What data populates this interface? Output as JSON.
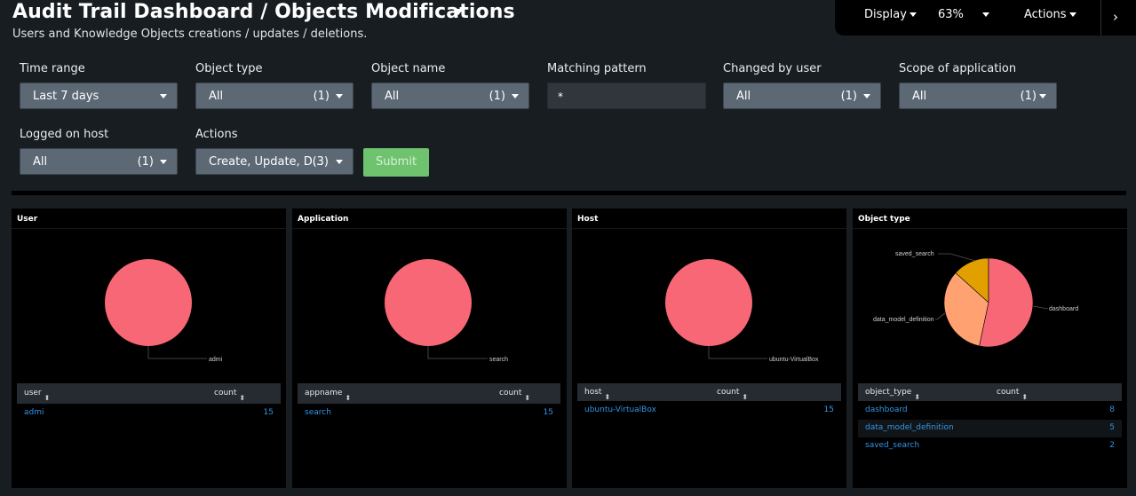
{
  "header": {
    "title": "Audit Trail Dashboard / Objects Modifications",
    "subtitle": "Users and Knowledge Objects creations / updates / deletions."
  },
  "toolbar": {
    "display": "Display",
    "zoom": "63%",
    "actions": "Actions"
  },
  "filters": {
    "time_range": {
      "label": "Time range",
      "value": "Last 7 days"
    },
    "object_type": {
      "label": "Object type",
      "value": "All",
      "count": "(1)"
    },
    "object_name": {
      "label": "Object name",
      "value": "All",
      "count": "(1)"
    },
    "matching_pattern": {
      "label": "Matching pattern",
      "value": "*"
    },
    "changed_by_user": {
      "label": "Changed by user",
      "value": "All",
      "count": "(1)"
    },
    "scope": {
      "label": "Scope of application",
      "value": "All",
      "count": "(1)"
    },
    "host": {
      "label": "Logged on host",
      "value": "All",
      "count": "(1)"
    },
    "actions": {
      "label": "Actions",
      "value": "Create, Update, D...",
      "count": "(3)"
    },
    "submit_label": "Submit"
  },
  "panels": {
    "user": {
      "title": "User",
      "columns": [
        "user",
        "count"
      ],
      "rows": [
        [
          "admi",
          "15"
        ]
      ]
    },
    "application": {
      "title": "Application",
      "columns": [
        "appname",
        "count"
      ],
      "rows": [
        [
          "search",
          "15"
        ]
      ]
    },
    "host": {
      "title": "Host",
      "columns": [
        "host",
        "count"
      ],
      "rows": [
        [
          "ubuntu-VirtualBox",
          "15"
        ]
      ]
    },
    "object_type": {
      "title": "Object type",
      "columns": [
        "object_type",
        "count"
      ],
      "rows": [
        [
          "dashboard",
          "8"
        ],
        [
          "data_model_definition",
          "5"
        ],
        [
          "saved_search",
          "2"
        ]
      ]
    }
  },
  "colors": {
    "pie_primary": "#f86775",
    "pie_secondary": "#ffa171",
    "pie_tertiary": "#e1a000",
    "link": "#2f95e8"
  },
  "chart_data": [
    {
      "type": "pie",
      "title": "User",
      "categories": [
        "admi"
      ],
      "values": [
        15
      ]
    },
    {
      "type": "pie",
      "title": "Application",
      "categories": [
        "search"
      ],
      "values": [
        15
      ]
    },
    {
      "type": "pie",
      "title": "Host",
      "categories": [
        "ubuntu-VirtualBox"
      ],
      "values": [
        15
      ]
    },
    {
      "type": "pie",
      "title": "Object type",
      "categories": [
        "dashboard",
        "data_model_definition",
        "saved_search"
      ],
      "values": [
        8,
        5,
        2
      ]
    }
  ]
}
